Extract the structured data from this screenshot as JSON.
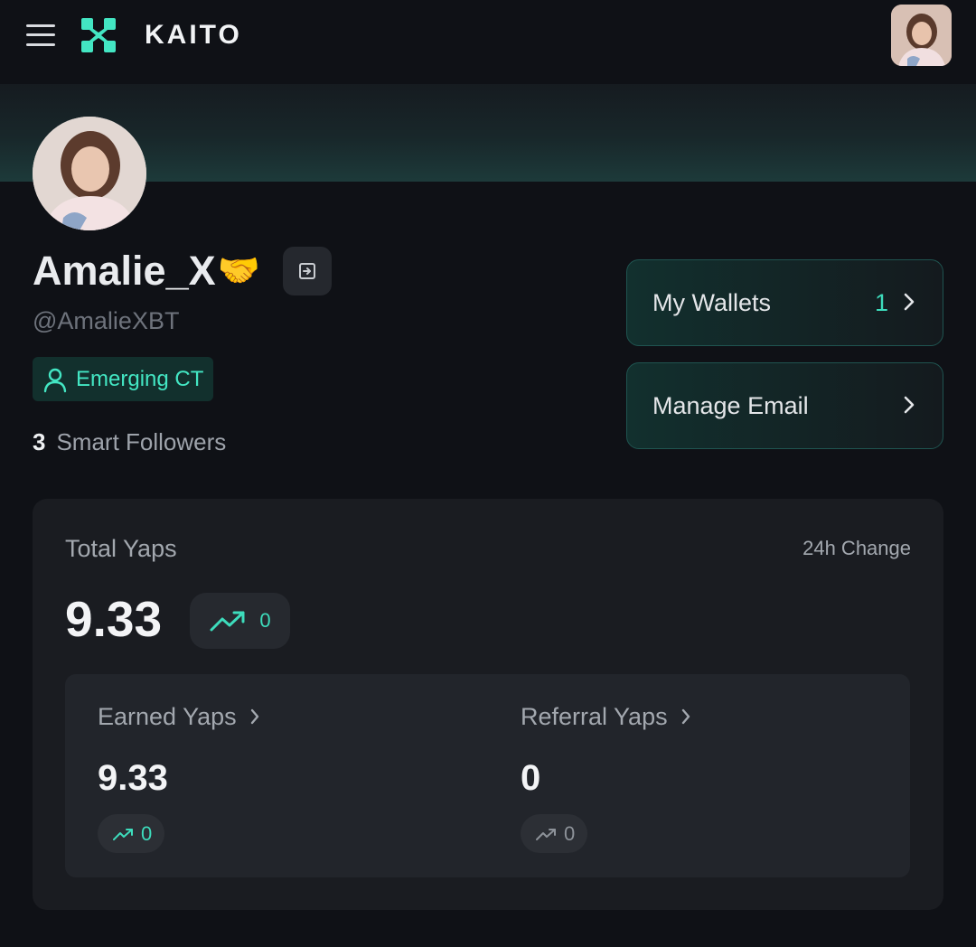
{
  "header": {
    "brand": "KAITO"
  },
  "profile": {
    "display_name": "Amalie_X",
    "name_emoji": "🤝",
    "handle": "@AmalieXBT",
    "badge_label": "Emerging CT",
    "smart_followers_count": "3",
    "smart_followers_label": "Smart Followers"
  },
  "actions": {
    "wallets_label": "My Wallets",
    "wallets_count": "1",
    "email_label": "Manage Email"
  },
  "yaps": {
    "title": "Total Yaps",
    "change_label": "24h Change",
    "total": "9.33",
    "total_change": "0",
    "earned": {
      "label": "Earned Yaps",
      "value": "9.33",
      "change": "0"
    },
    "referral": {
      "label": "Referral Yaps",
      "value": "0",
      "change": "0"
    }
  },
  "colors": {
    "accent": "#3ddcbc",
    "background": "#0f1116",
    "card": "#1a1c21"
  }
}
